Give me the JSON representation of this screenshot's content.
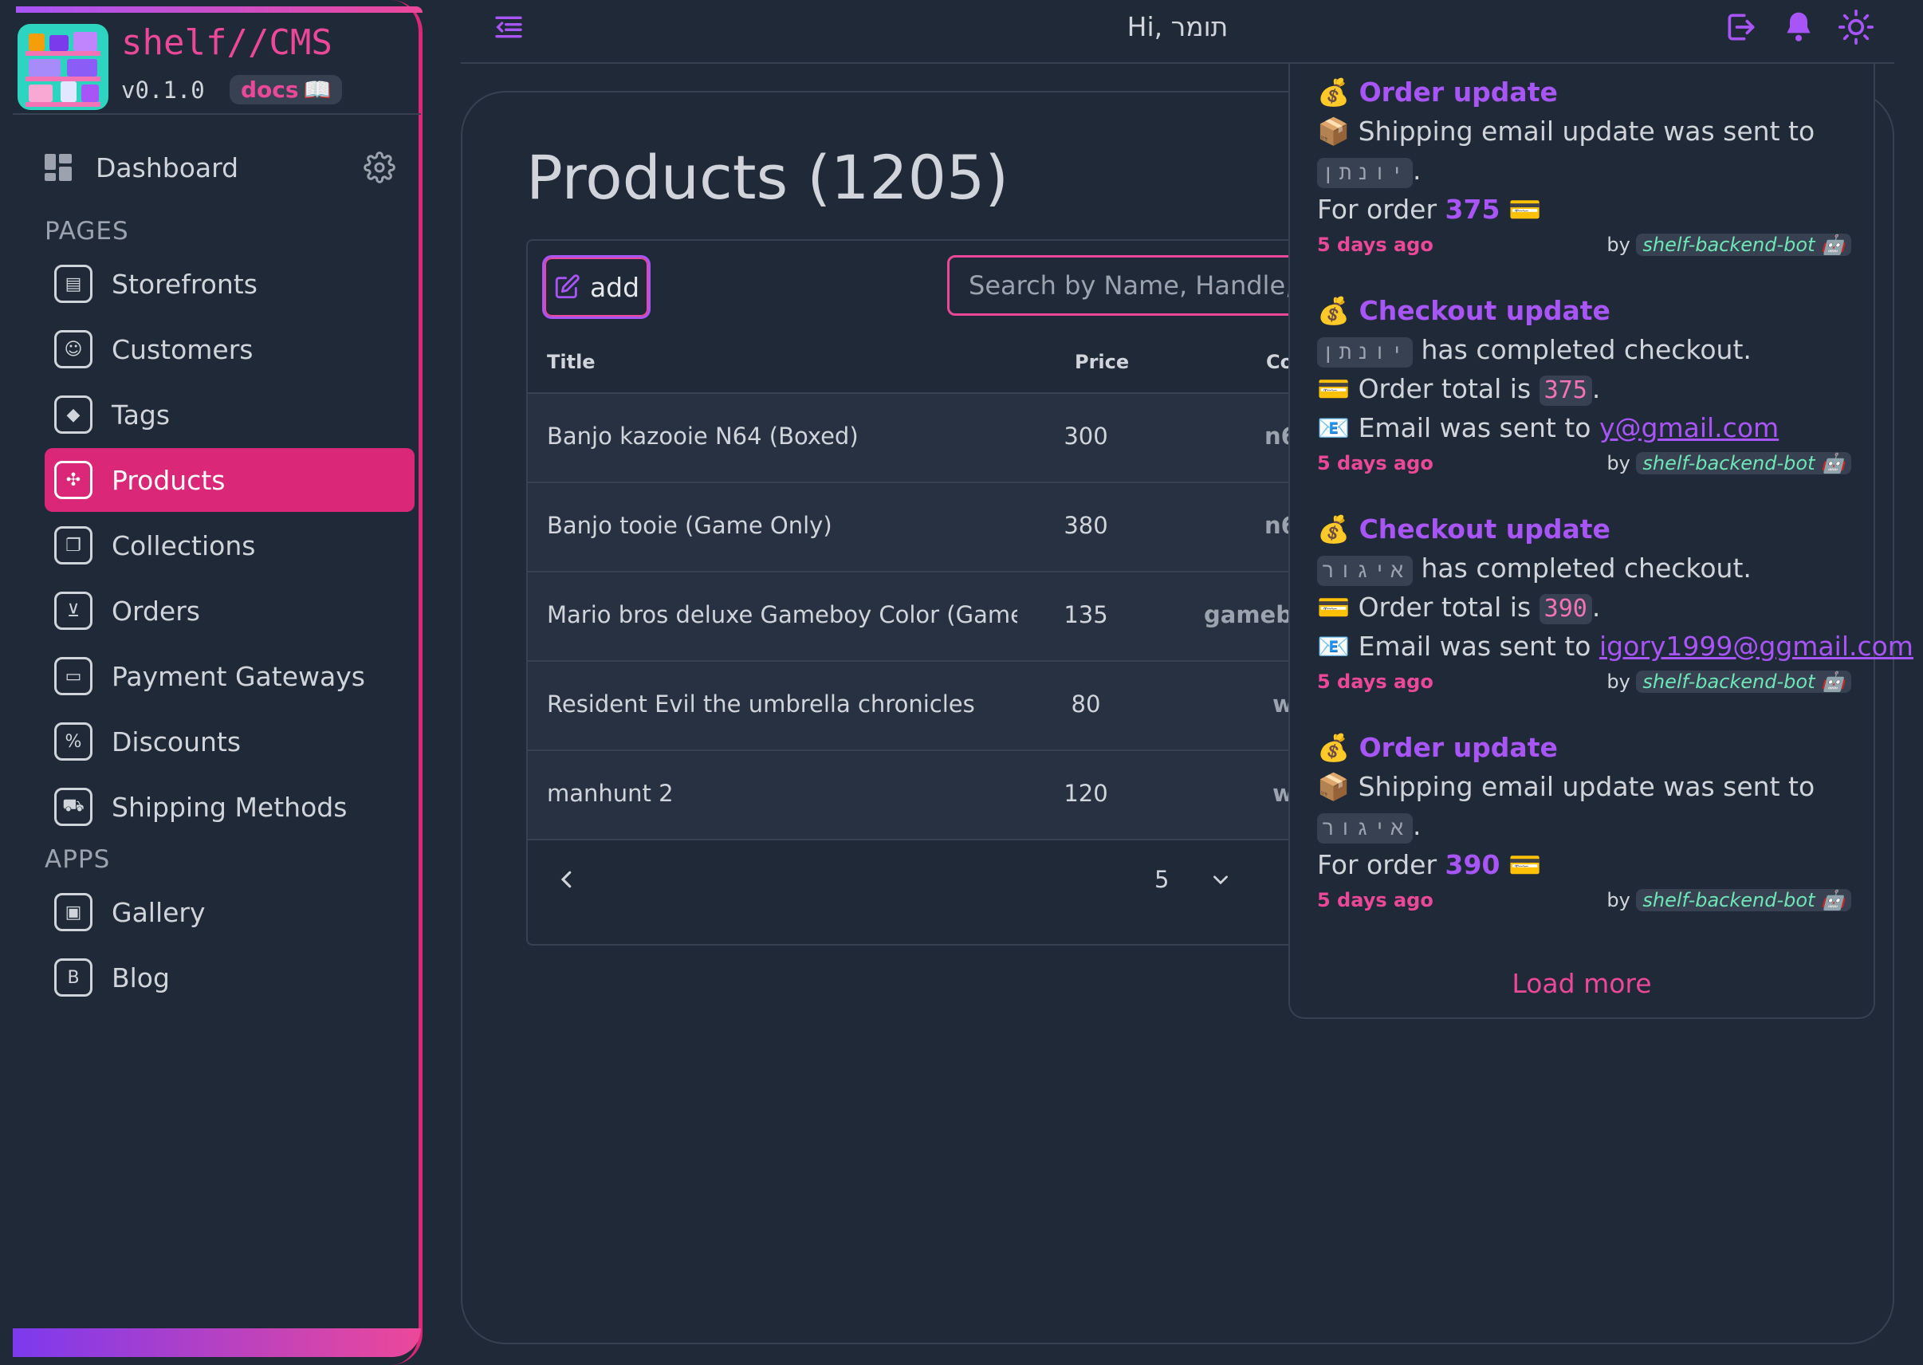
{
  "brand": {
    "name": "shelf//CMS",
    "version": "v0.1.0",
    "docs_label": "docs",
    "docs_icon": "📖"
  },
  "sidebar": {
    "dashboard_label": "Dashboard",
    "pages_label": "PAGES",
    "apps_label": "APPS",
    "pages": [
      {
        "label": "Storefronts",
        "icon": "storefront-icon"
      },
      {
        "label": "Customers",
        "icon": "user-icon"
      },
      {
        "label": "Tags",
        "icon": "tag-icon"
      },
      {
        "label": "Products",
        "icon": "gamepad-icon",
        "active": true
      },
      {
        "label": "Collections",
        "icon": "collections-icon"
      },
      {
        "label": "Orders",
        "icon": "cart-icon"
      },
      {
        "label": "Payment Gateways",
        "icon": "credit-card-icon"
      },
      {
        "label": "Discounts",
        "icon": "discount-icon"
      },
      {
        "label": "Shipping Methods",
        "icon": "truck-icon"
      }
    ],
    "apps": [
      {
        "label": "Gallery",
        "icon": "gallery-icon"
      },
      {
        "label": "Blog",
        "icon": "blog-icon"
      }
    ]
  },
  "header": {
    "greeting": "Hi, תומר"
  },
  "products": {
    "title": "Products (1205)",
    "add_label": "add",
    "search_placeholder": "Search by Name, Handle, Tag",
    "columns": {
      "title": "Title",
      "price": "Price",
      "collections": "Co"
    },
    "rows": [
      {
        "title": "Banjo kazooie N64 (Boxed)",
        "price": "300",
        "collection": "n6"
      },
      {
        "title": "Banjo tooie (Game Only)",
        "price": "380",
        "collection": "n6"
      },
      {
        "title": "Mario bros deluxe Gameboy Color (Game Only)",
        "price": "135",
        "collection": "gamebo"
      },
      {
        "title": "Resident Evil the umbrella chronicles",
        "price": "80",
        "collection": "w"
      },
      {
        "title": "manhunt 2",
        "price": "120",
        "collection": "w"
      }
    ],
    "page_size": "5"
  },
  "notifications": {
    "items": [
      {
        "emoji": "💰",
        "title": "Order update",
        "l1_prefix": "📦 Shipping email update was sent to",
        "name": "יונתן",
        "l2_prefix": "For order",
        "order": "375",
        "l2_suffix": "💳",
        "time": "5 days ago",
        "by": "by",
        "bot": "shelf-backend-bot 🤖"
      },
      {
        "emoji": "💰",
        "title": "Checkout update",
        "name": "יונתן",
        "l1_suffix": "has completed checkout.",
        "total_prefix": "💳 Order total is",
        "total": "375",
        "email_prefix": "📧 Email was sent to",
        "email": "y@gmail.com",
        "time": "5 days ago",
        "by": "by",
        "bot": "shelf-backend-bot 🤖"
      },
      {
        "emoji": "💰",
        "title": "Checkout update",
        "name": "איגור",
        "l1_suffix": "has completed checkout.",
        "total_prefix": "💳 Order total is",
        "total": "390",
        "email_prefix": "📧 Email was sent to",
        "email": "igory1999@ggmail.com",
        "time": "5 days ago",
        "by": "by",
        "bot": "shelf-backend-bot 🤖"
      },
      {
        "emoji": "💰",
        "title": "Order update",
        "l1_prefix": "📦 Shipping email update was sent to",
        "name": "איגור",
        "l2_prefix": "For order",
        "order": "390",
        "l2_suffix": "💳",
        "time": "5 days ago",
        "by": "by",
        "bot": "shelf-backend-bot 🤖"
      }
    ],
    "load_more": "Load more"
  },
  "colors": {
    "accent": "#db2777",
    "purple": "#a855f7",
    "background": "#1f2937"
  }
}
